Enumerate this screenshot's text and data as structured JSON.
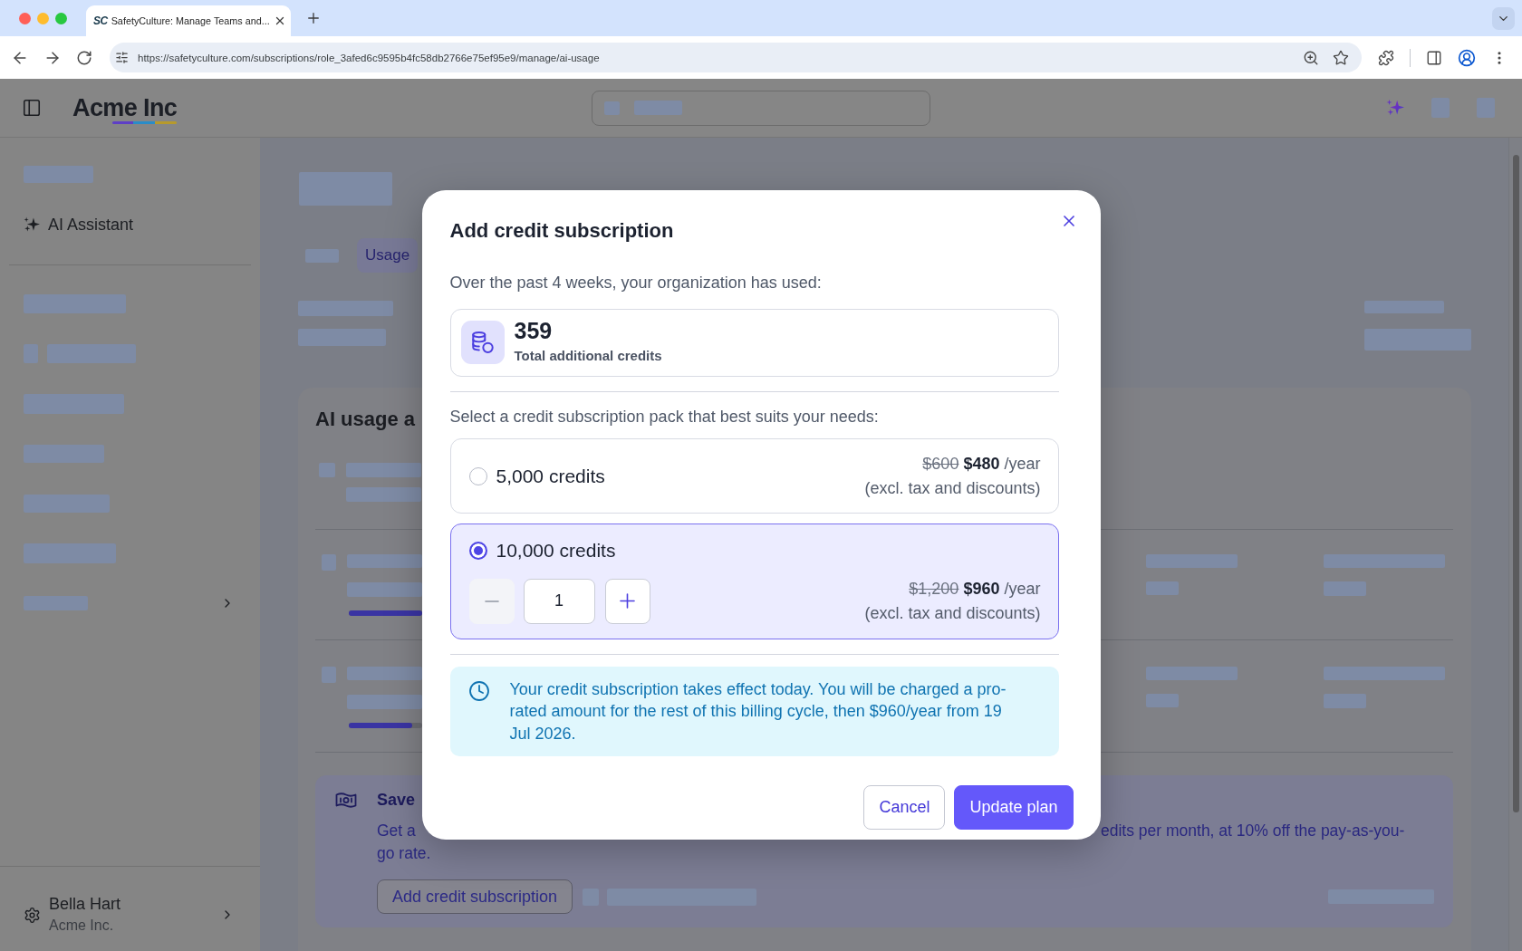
{
  "browser": {
    "tabs": [
      {
        "favicon": "SC",
        "title": "SafetyCulture: Manage Teams and...",
        "selected": true
      }
    ],
    "url": "https://safetyculture.com/subscriptions/role_3afed6c9595b4fc58db2766e75ef95e9/manage/ai-usage"
  },
  "header": {
    "logo": "Acme Inc"
  },
  "sidebar": {
    "items": [
      {
        "label": "AI Assistant"
      }
    ],
    "user": {
      "name": "Bella Hart",
      "organization": "Acme Inc."
    }
  },
  "page": {
    "tabs": [
      {
        "label": "Usage",
        "selected": true
      }
    ],
    "card": {
      "title": "AI usage a",
      "usage_rows": [
        {
          "level": 1
        },
        {
          "level": 0.87
        }
      ],
      "banner": {
        "title": "Save",
        "text_start": "Get a",
        "text_cut": "edits per month, at 10% off the pay-as-you-",
        "text_end": "go rate.",
        "button": "Add credit subscription"
      }
    }
  },
  "dialog": {
    "title": "Add credit subscription",
    "intro": "Over the past 4 weeks, your organization has used:",
    "usage": {
      "value": "359",
      "label": "Total additional credits"
    },
    "prompt": "Select a credit subscription pack that best suits your needs:",
    "packs": [
      {
        "label": "5,000 credits",
        "old_price": "$600",
        "price": "$480",
        "period": "/year",
        "note": "(excl. tax and discounts)",
        "selected": false
      },
      {
        "label": "10,000 credits",
        "old_price": "$1,200",
        "price": "$960",
        "period": "/year",
        "note": "(excl. tax and discounts)",
        "selected": true,
        "stepper": {
          "quantity": "1",
          "decrease_disabled": true
        }
      }
    ],
    "notice": "Your credit subscription takes effect today. You will be charged a pro-rated amount for the rest of this billing cycle, then $960/year from 19 Jul 2026.",
    "buttons": [
      {
        "label": "Cancel",
        "kind": "cancel"
      },
      {
        "label": "Update plan",
        "kind": "primary"
      }
    ]
  }
}
